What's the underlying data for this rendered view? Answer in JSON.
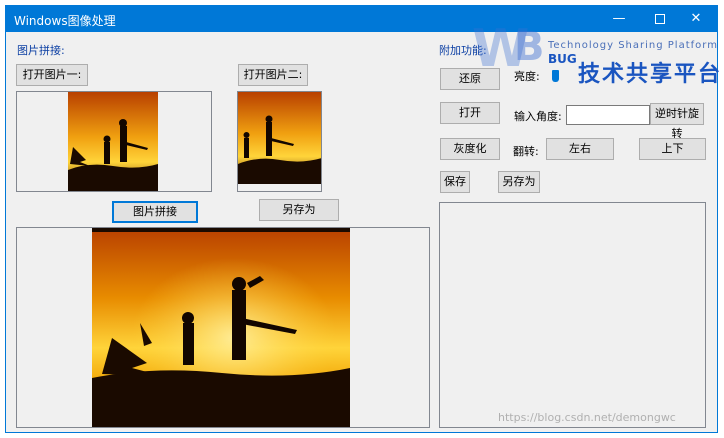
{
  "window": {
    "title": "Windows图像处理",
    "minimize_glyph": "—",
    "close_glyph": "✕"
  },
  "left": {
    "section_label": "图片拼接:",
    "open_image1_label": "打开图片一:",
    "open_image2_label": "打开图片二:",
    "stitch_label": "图片拼接",
    "save_as_label": "另存为"
  },
  "right": {
    "section_label": "附加功能:",
    "restore_label": "还原",
    "brightness_label": "亮度:",
    "open_label": "打开",
    "angle_label": "输入角度:",
    "angle_value": "",
    "rotate_ccw_label": "逆时针旋转",
    "grayscale_label": "灰度化",
    "flip_label": "翻转:",
    "flip_lr_label": "左右",
    "flip_ud_label": "上下",
    "save_label": "保存",
    "save_as_label": "另存为"
  },
  "logo": {
    "tagline": "Technology Sharing Platform",
    "cn_name": "技术共享平台",
    "bug_text": "BUG"
  },
  "watermark": {
    "text": "https://blog.csdn.net/demongwc"
  },
  "colors": {
    "title_bar": "#0078d7",
    "accent": "#0078d7",
    "sky_top": "#c24a00",
    "sky_mid": "#f2a000",
    "sky_glow": "#ffe14a"
  }
}
